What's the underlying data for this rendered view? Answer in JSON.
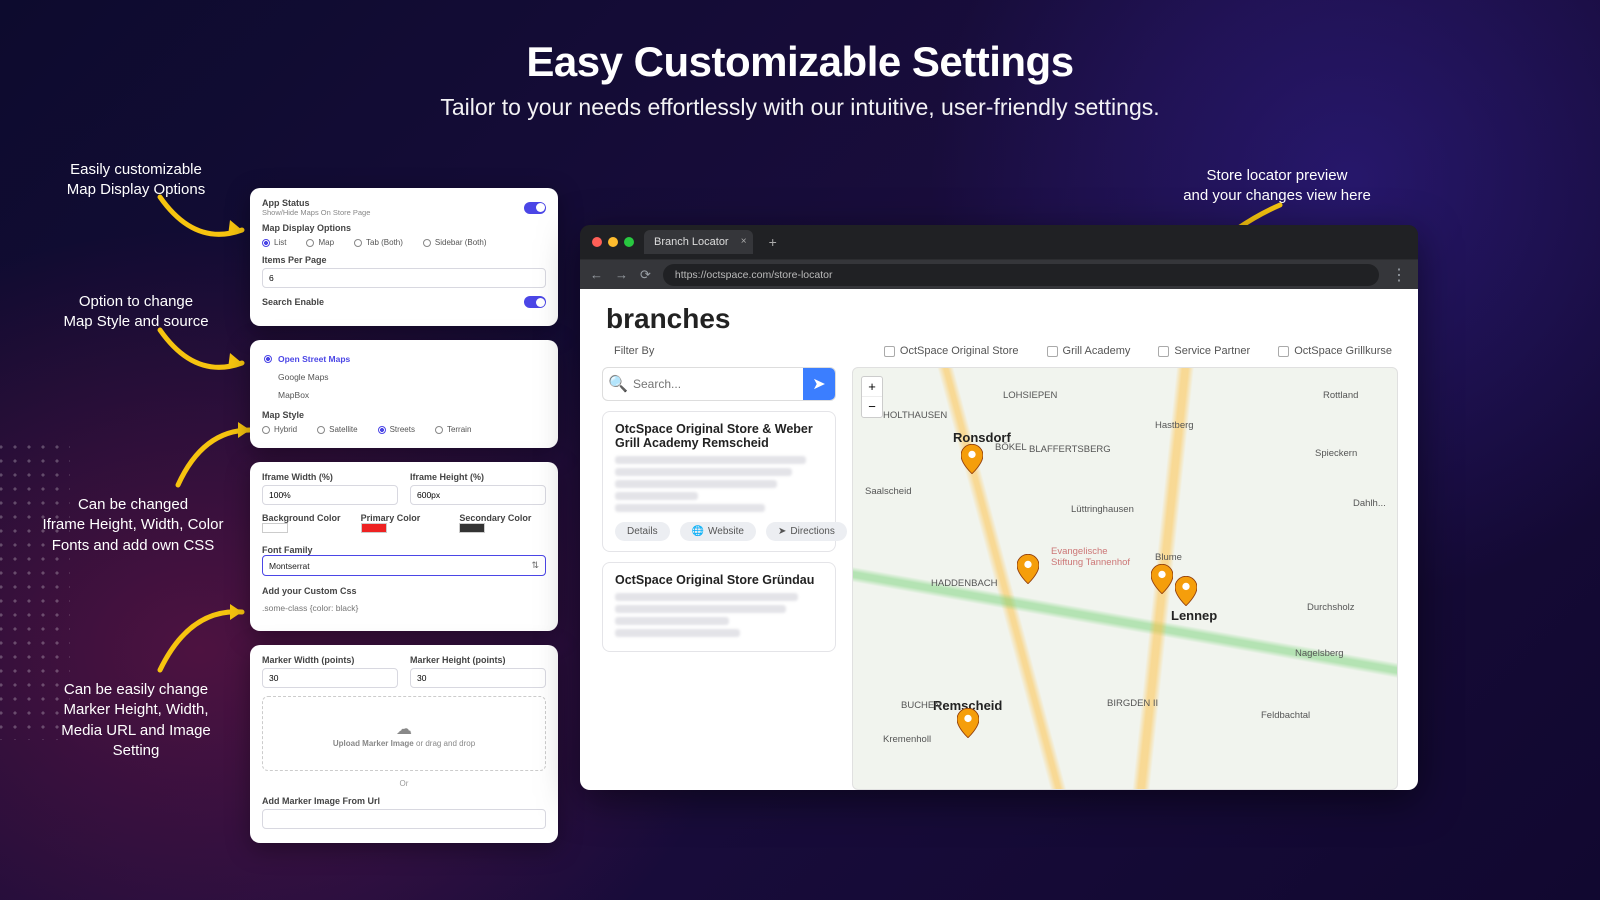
{
  "hero": {
    "title": "Easy Customizable Settings",
    "subtitle": "Tailor to your needs effortlessly with our intuitive, user-friendly settings."
  },
  "annotations": {
    "a1": "Easily customizable\nMap Display Options",
    "a2": "Option to change\nMap Style and source",
    "a3": "Can be changed\nIframe Height, Width, Color\nFonts and add own CSS",
    "a4": "Can be easily change\nMarker Height, Width,\nMedia URL and Image\nSetting",
    "a5": "Store locator preview\nand your changes view here"
  },
  "card1": {
    "app_status_label": "App Status",
    "app_status_sub": "Show/Hide Maps On Store Page",
    "display_options_label": "Map Display Options",
    "opts": {
      "list": "List",
      "map": "Map",
      "tab": "Tab (Both)",
      "sidebar": "Sidebar (Both)"
    },
    "items_per_page_label": "Items Per Page",
    "items_per_page_value": "6",
    "search_enable_label": "Search Enable"
  },
  "card2": {
    "sources": {
      "osm": "Open Street Maps",
      "google": "Google Maps",
      "mapbox": "MapBox"
    },
    "map_style_label": "Map Style",
    "styles": {
      "hybrid": "Hybrid",
      "satellite": "Satellite",
      "streets": "Streets",
      "terrain": "Terrain"
    }
  },
  "card3": {
    "iframe_w_label": "Iframe Width (%)",
    "iframe_w_value": "100%",
    "iframe_h_label": "Iframe Height (%)",
    "iframe_h_value": "600px",
    "bg_label": "Background Color",
    "primary_label": "Primary Color",
    "secondary_label": "Secondary Color",
    "font_label": "Font Family",
    "font_value": "Montserrat",
    "css_label": "Add your Custom Css",
    "css_placeholder": ".some-class {color: black}"
  },
  "card4": {
    "mw_label": "Marker Width (points)",
    "mw_value": "30",
    "mh_label": "Marker Height (points)",
    "mh_value": "30",
    "upload_text_a": "Upload Marker Image",
    "upload_text_b": " or drag and drop",
    "or": "Or",
    "url_label": "Add Marker Image From Url"
  },
  "browser": {
    "tab_title": "Branch Locator",
    "url": "https://octspace.com/store-locator",
    "page_title": "branches",
    "filter_label": "Filter By",
    "filters": {
      "f1": "OctSpace Original Store",
      "f2": "Grill Academy",
      "f3": "Service Partner",
      "f4": "OctSpace Grillkurse"
    },
    "search_placeholder": "Search...",
    "store1_title": "OtcSpace Original Store & Weber Grill Academy Remscheid",
    "store2_title": "OctSpace Original Store Gründau",
    "btn_details": "Details",
    "btn_website": "Website",
    "btn_directions": "Directions",
    "zoom_in": "+",
    "zoom_out": "−",
    "city_ronsdorf": "Ronsdorf",
    "city_lennep": "Lennep",
    "city_remscheid": "Remscheid",
    "labels": {
      "lohsiepen": "LOHSIEPEN",
      "holthausen": "HOLTHAUSEN",
      "blaffertsberg": "BLAFFERTSBERG",
      "saalscheid": "Saalscheid",
      "luttring": "Lüttringhausen",
      "haddenbach": "HADDENBACH",
      "hastberg": "Hastberg",
      "blume": "Blume",
      "rottland": "Rottland",
      "spieckern": "Spieckern",
      "durchsholz": "Durchsholz",
      "dahlhn": "Dahlh...",
      "nagelsberg": "Nagelsberg",
      "buchen": "BUCHEN",
      "birgden": "BIRGDEN II",
      "feldbachtal": "Feldbachtal",
      "kremenholl": "Kremenholl",
      "evang": "Evangelische\nStiftung Tannenhof",
      "bokel": "BÖKEL"
    }
  }
}
